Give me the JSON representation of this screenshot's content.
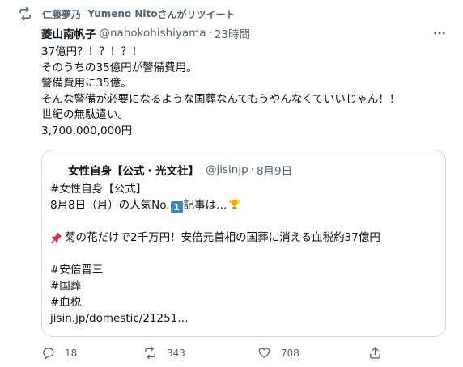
{
  "retweet": {
    "icon": "retweet-icon",
    "retweeter": "仁藤夢乃",
    "retweeter_en": "Yumeno Nito",
    "suffix": "さんがリツイート"
  },
  "tweet": {
    "display_name": "菱山南帆子",
    "handle": "@nahokohishiyama",
    "separator": "·",
    "time": "23時間",
    "lines": [
      "37億円？！？！？！",
      "そのうちの35億円が警備費用。",
      "警備費用に35億。",
      "そんな警備が必要になるような国葬なんてもうやんなくていいじゃん！！",
      "世紀の無駄遣い。",
      "3,700,000,000円"
    ]
  },
  "quote": {
    "display_name": "女性自身【公式・光文社】",
    "handle": "@jisinjp",
    "separator": "·",
    "time": "8月9日",
    "line1": "#女性自身【公式】",
    "line2_a": "8月8日（月）の人気No.",
    "line2_emoji": "1",
    "line2_b": "記事は…",
    "line3": "菊の花だけで2千万円！安倍元首相の国葬に消える血税約37億円",
    "line4": "#安倍晋三",
    "line5": "#国葬",
    "line6": "#血税",
    "link": "jisin.jp/domestic/21251…"
  },
  "actions": {
    "reply_count": "18",
    "retweet_count": "343",
    "like_count": "708"
  },
  "colors": {
    "text": "#0f1419",
    "secondary": "#536471",
    "border": "#cfd9de"
  }
}
